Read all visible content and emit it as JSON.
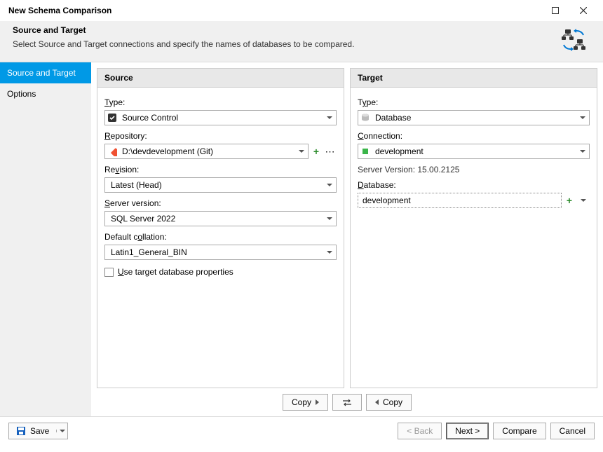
{
  "window": {
    "title": "New Schema Comparison"
  },
  "header": {
    "title": "Source and Target",
    "description": "Select Source and Target connections and specify the names of databases to be compared."
  },
  "sidebar": {
    "items": [
      {
        "label": "Source and Target",
        "active": true
      },
      {
        "label": "Options",
        "active": false
      }
    ]
  },
  "source": {
    "title": "Source",
    "type_label": "Type:",
    "type_value": "Source Control",
    "repository_label": "Repository:",
    "repository_value": "D:\\devdevelopment (Git)",
    "revision_label": "Revision:",
    "revision_value": "Latest (Head)",
    "server_label": "Server version:",
    "server_value": "SQL Server 2022",
    "collation_label": "Default collation:",
    "collation_value": "Latin1_General_BIN",
    "use_target_label": "Use target database properties"
  },
  "target": {
    "title": "Target",
    "type_label": "Type:",
    "type_value": "Database",
    "connection_label": "Connection:",
    "connection_value": "development",
    "server_version_label": "Server Version: 15.00.2125",
    "database_label": "Database:",
    "database_value": "development"
  },
  "copybar": {
    "copy_right": "Copy",
    "copy_left": "Copy"
  },
  "footer": {
    "save": "Save",
    "back": "< Back",
    "next": "Next >",
    "compare": "Compare",
    "cancel": "Cancel"
  }
}
